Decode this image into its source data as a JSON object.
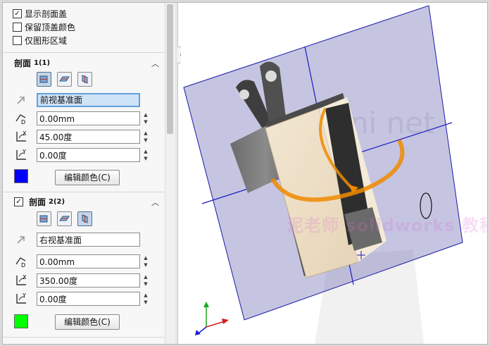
{
  "options": [
    {
      "label": "显示剖面盖",
      "checked": true
    },
    {
      "label": "保留顶盖颜色",
      "checked": false
    },
    {
      "label": "仅图形区域",
      "checked": false
    }
  ],
  "section1": {
    "title": "剖面",
    "index": "1(1)",
    "plane": "前视基准面",
    "offset": "0.00mm",
    "angle_x": "45.00度",
    "angle_y": "0.00度",
    "color": "#0000ff",
    "edit_color_label": "编辑颜色(C)"
  },
  "section2": {
    "title": "剖面",
    "index": "2(2)",
    "enabled": true,
    "plane": "右视基准面",
    "offset": "0.00mm",
    "angle_x": "350.00度",
    "angle_y": "0.00度",
    "color": "#00ff00",
    "edit_color_label": "编辑颜色(C)"
  },
  "icons": {
    "collapse": "chevron-up-icon",
    "plane_buttons": [
      "front-plane-icon",
      "top-plane-icon",
      "right-plane-icon"
    ],
    "offset": "offset-distance-icon",
    "rotate_x": "rotate-x-icon",
    "rotate_y": "rotate-y-icon"
  },
  "watermark": "泥老师 solidworks 教程",
  "colors": {
    "section_plane": "#5a5aa8",
    "selection_highlight": "#cfe3f7",
    "manipulator": "#f08a00"
  }
}
